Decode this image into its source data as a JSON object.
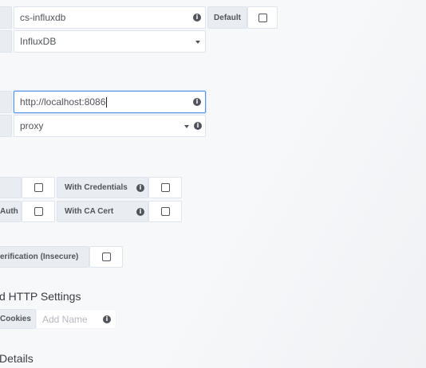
{
  "http": {
    "name": {
      "value": "cs-influxdb",
      "default_label": "Default"
    },
    "type": {
      "value": "InfluxDB"
    },
    "url": {
      "value": "http://localhost:8086"
    },
    "access": {
      "value": "proxy"
    }
  },
  "auth": {
    "row1": {
      "right_label": "With Credentials"
    },
    "row2": {
      "left_label_fragment": "Auth",
      "right_label": "With CA Cert"
    },
    "skip_tls": {
      "label_fragment": "erification (Insecure)"
    }
  },
  "advanced": {
    "title": "d HTTP Settings",
    "cookies_label": "Cookies",
    "cookies_placeholder": "Add Name"
  },
  "details": {
    "title": "Details"
  }
}
